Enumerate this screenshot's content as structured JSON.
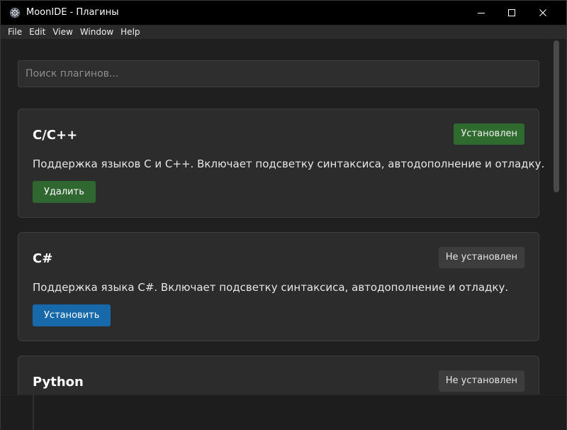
{
  "window": {
    "title": "MoonIDE - Плагины",
    "icon": "moon-gear-icon"
  },
  "titlebar_controls": {
    "minimize": "minimize-icon",
    "maximize": "maximize-icon",
    "close": "close-icon"
  },
  "menu": {
    "items": [
      "File",
      "Edit",
      "View",
      "Window",
      "Help"
    ]
  },
  "search": {
    "placeholder": "Поиск плагинов..."
  },
  "plugins": [
    {
      "name": "C/C++",
      "status": "Установлен",
      "description": "Поддержка языков C и C++. Включает подсветку синтаксиса, автодополнение и отладку.",
      "action": "Удалить"
    },
    {
      "name": "C#",
      "status": "Не установлен",
      "description": "Поддержка языка C#. Включает подсветку синтаксиса, автодополнение и отладку.",
      "action": "Установить"
    },
    {
      "name": "Python",
      "status": "Не установлен"
    }
  ],
  "colors": {
    "installed_badge": "#2f6b2f",
    "remove_button": "#30662f",
    "install_button": "#1769aa",
    "not_installed_badge": "#3d3d3d"
  }
}
